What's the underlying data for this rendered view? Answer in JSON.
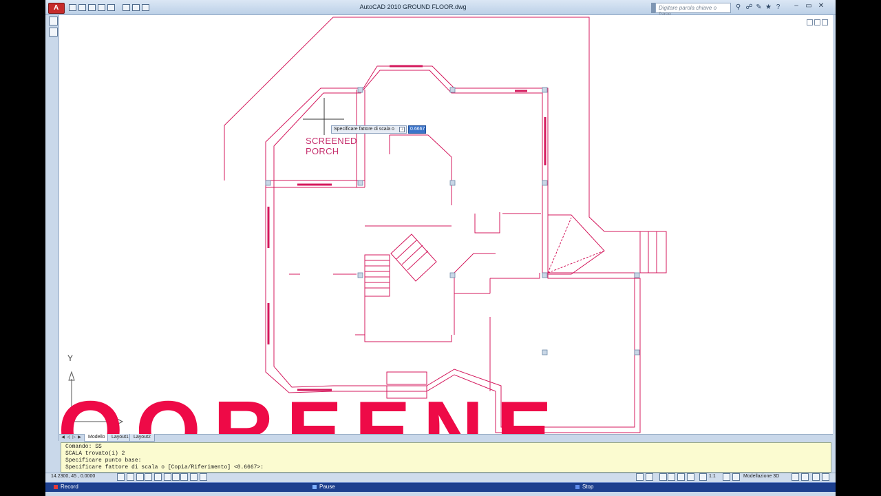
{
  "window": {
    "title": "AutoCAD 2010    GROUND FLOOR.dwg",
    "app_button": "A",
    "search_placeholder": "Digitare parola chiave o frase"
  },
  "drawing": {
    "room_label": "SCREENED\nPORCH",
    "big_text": "OOREENE",
    "ucs_y_label": "Y",
    "line_color": "#d4195d",
    "tooltip_prompt": "Specificare fattore di scala o",
    "tooltip_arrow": "↓",
    "dynamic_input_value": "0.6667"
  },
  "tabs": [
    {
      "label": "Modello",
      "active": true
    },
    {
      "label": "Layout1",
      "active": false
    },
    {
      "label": "Layout2",
      "active": false
    }
  ],
  "command_line": {
    "lines": [
      "Comando: SS",
      "SCALA trovato(i) 2",
      "Specificare punto base:",
      "Specificare fattore di scala o [Copia/Riferimento] <0.6667>:"
    ]
  },
  "status_bar": {
    "coordinates": "14.2300, 45   , 0.0000",
    "annotation_scale": "1:1",
    "workspace": "Modellazione 3D"
  },
  "recorder": {
    "record_label": "Record",
    "pause_label": "Pause",
    "stop_label": "Stop"
  },
  "colors": {
    "accent_red": "#ee0a47",
    "command_bg": "#fbfbd0",
    "recorder_bg": "#1c3f8e"
  }
}
